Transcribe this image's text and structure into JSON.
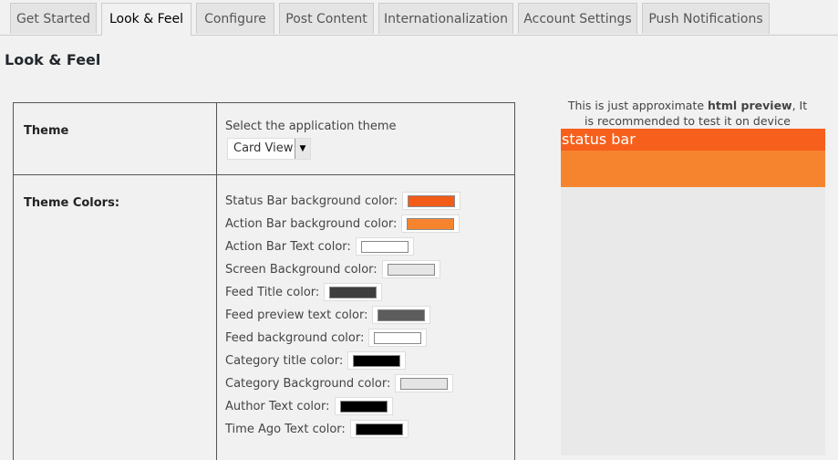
{
  "tabs": [
    {
      "label": "Get Started"
    },
    {
      "label": "Look & Feel"
    },
    {
      "label": "Configure"
    },
    {
      "label": "Post Content"
    },
    {
      "label": "Internationalization"
    },
    {
      "label": "Account Settings"
    },
    {
      "label": "Push Notifications"
    }
  ],
  "page_title": "Look & Feel",
  "theme": {
    "label": "Theme",
    "description": "Select the application theme",
    "selected": "Card View"
  },
  "colors": {
    "label": "Theme Colors:",
    "items": [
      {
        "label": "Status Bar background color:",
        "color": "#f35c18"
      },
      {
        "label": "Action Bar background color:",
        "color": "#f6842e"
      },
      {
        "label": "Action Bar Text color:",
        "color": "#ffffff"
      },
      {
        "label": "Screen Background color:",
        "color": "#e5e5e5"
      },
      {
        "label": "Feed Title color:",
        "color": "#3e3e3e"
      },
      {
        "label": "Feed preview text color:",
        "color": "#5c5c5c"
      },
      {
        "label": "Feed background color:",
        "color": "#ffffff"
      },
      {
        "label": "Category title color:",
        "color": "#000000"
      },
      {
        "label": "Category Background color:",
        "color": "#e5e5e5"
      },
      {
        "label": "Author Text color:",
        "color": "#000000"
      },
      {
        "label": "Time Ago Text color:",
        "color": "#000000"
      }
    ]
  },
  "preview": {
    "note_before": "This is just approximate ",
    "note_bold": "html preview",
    "note_after": ", It is recommended to test it on device directly.",
    "status_text": "status bar",
    "status_color": "#f65f1c",
    "action_color": "#f6842e"
  }
}
